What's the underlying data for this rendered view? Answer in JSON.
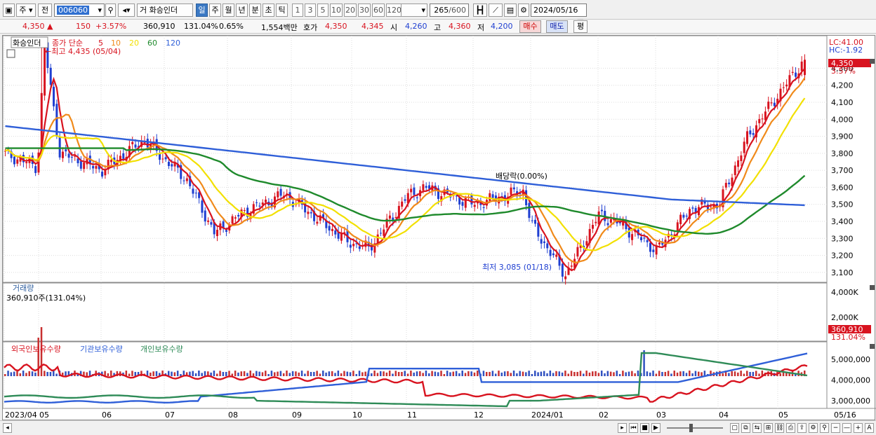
{
  "toolbar": {
    "market_label": "주",
    "prev_label": "전",
    "code_value": "006060",
    "type_label": "거",
    "stock_name": "화승인더",
    "periods": [
      "일",
      "주",
      "월",
      "년",
      "분",
      "초",
      "틱"
    ],
    "selected_period": "일",
    "counts": [
      "1",
      "3",
      "5",
      "10",
      "20",
      "30",
      "60",
      "120"
    ],
    "range_value": "265",
    "range_total": "/600",
    "date_value": "2024/05/16"
  },
  "quote": {
    "price": "4,350",
    "change": "150",
    "change_pct": "+3.57%",
    "volume": "360,910",
    "vol_ratio": "131.04%",
    "turnover": "0.65%",
    "amount": "1,554백만",
    "ask_label": "호가",
    "ask": "4,350",
    "bid": "4,345",
    "open_label": "시",
    "open": "4,260",
    "high_label": "고",
    "high": "4,360",
    "low_label": "저",
    "low": "4,200",
    "buy_label": "매수",
    "sell_label": "매도",
    "eval_label": "평"
  },
  "price_panel": {
    "stock_label": "화승인더",
    "indicator_label": "종가 단순",
    "ma_periods": [
      "5",
      "10",
      "20",
      "60",
      "120"
    ],
    "high_annotation": "←최고 4,435 (05/04)",
    "low_annotation": "최저 3,085 (01/18)",
    "dividend_annotation": "배당락(0.00%)",
    "lc_label": "LC:41.00",
    "hc_label": "HC:-1.92",
    "current_tag": "4,350",
    "current_pct": "3.57%",
    "y_ticks": [
      "4,300",
      "4,200",
      "4,100",
      "4,000",
      "3,900",
      "3,800",
      "3,700",
      "3,600",
      "3,500",
      "3,400",
      "3,300",
      "3,200",
      "3,100"
    ]
  },
  "volume_panel": {
    "label": "거래량",
    "value_text": "360,910주(131.04%)",
    "y_ticks": [
      "4,000K",
      "2,000K"
    ],
    "current_tag": "360,910",
    "current_pct": "131.04%"
  },
  "holding_panel": {
    "series_labels": [
      "외국인보유수량",
      "기관보유수량",
      "개인보유수량"
    ],
    "y_ticks": [
      "5,000,000",
      "4,000,000",
      "3,000,000"
    ]
  },
  "x_axis": [
    "2023/04",
    "05",
    "06",
    "07",
    "08",
    "09",
    "10",
    "11",
    "12",
    "2024/01",
    "02",
    "03",
    "04",
    "05",
    "05/16"
  ],
  "colors": {
    "up": "#d8131f",
    "down": "#1f3fd1",
    "ma5": "#d8131f",
    "ma10": "#f08a1a",
    "ma20": "#f2e000",
    "ma60": "#1f8a2c",
    "ma120": "#2f5fd8",
    "foreign": "#d8131f",
    "institution": "#2f5fd8",
    "individual": "#2e8b57"
  },
  "chart_data": {
    "type": "candlestick",
    "price_anchors": [
      {
        "x": "2023/04",
        "y": 3800
      },
      {
        "x": "2023/05 start",
        "y": 3720
      },
      {
        "x": "2023/05/04",
        "y": 4435
      },
      {
        "x": "2023/05 mid",
        "y": 3800
      },
      {
        "x": "2023/06",
        "y": 3700
      },
      {
        "x": "2023/06 end",
        "y": 3880
      },
      {
        "x": "2023/07 start",
        "y": 3780
      },
      {
        "x": "2023/07 mid",
        "y": 3650
      },
      {
        "x": "2023/08",
        "y": 3330
      },
      {
        "x": "2023/08 mid",
        "y": 3450
      },
      {
        "x": "2023/09",
        "y": 3560
      },
      {
        "x": "2023/10",
        "y": 3280
      },
      {
        "x": "2023/10 mid",
        "y": 3240
      },
      {
        "x": "2023/11",
        "y": 3550
      },
      {
        "x": "2023/11 mid",
        "y": 3600
      },
      {
        "x": "2023/12",
        "y": 3500
      },
      {
        "x": "2023/12 end",
        "y": 3580
      },
      {
        "x": "2024/01",
        "y": 3380
      },
      {
        "x": "2024/01/18",
        "y": 3085
      },
      {
        "x": "2024/02",
        "y": 3440
      },
      {
        "x": "2024/02 mid",
        "y": 3380
      },
      {
        "x": "2024/03",
        "y": 3230
      },
      {
        "x": "2024/03 mid",
        "y": 3480
      },
      {
        "x": "2024/04",
        "y": 3500
      },
      {
        "x": "2024/04 mid",
        "y": 3900
      },
      {
        "x": "2024/05",
        "y": 4150
      },
      {
        "x": "2024/05/16",
        "y": 4350
      }
    ],
    "ylim": [
      3050,
      4450
    ]
  }
}
